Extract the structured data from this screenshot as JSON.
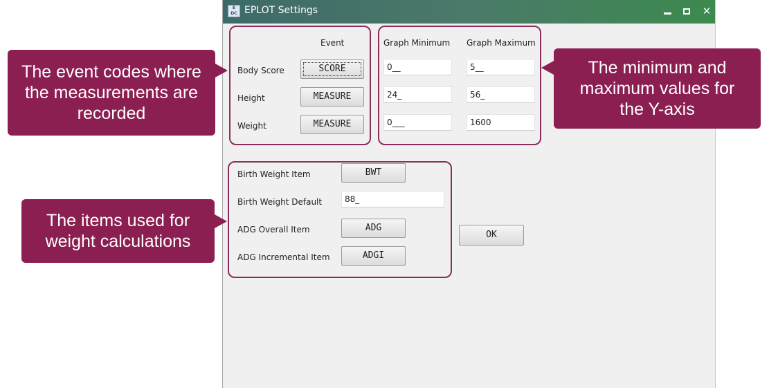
{
  "window": {
    "title": "EPLOT Settings",
    "icon": "eplot-app-icon",
    "minimize_icon": "minimize-icon",
    "maximize_icon": "maximize-icon",
    "close_icon": "close-icon",
    "close_glyph": "✕"
  },
  "event_section": {
    "header": "Event",
    "rows": [
      {
        "label": "Body Score",
        "button": "SCORE"
      },
      {
        "label": "Height",
        "button": "MEASURE"
      },
      {
        "label": "Weight",
        "button": "MEASURE"
      }
    ]
  },
  "graph_section": {
    "min_header": "Graph Minimum",
    "max_header": "Graph Maximum",
    "rows": [
      {
        "min": "0__",
        "max": "5__"
      },
      {
        "min": "24_",
        "max": "56_"
      },
      {
        "min": "0___",
        "max": "1600"
      }
    ]
  },
  "weight_section": {
    "birth_weight_item_label": "Birth Weight Item",
    "birth_weight_item_button": "BWT",
    "birth_weight_default_label": "Birth Weight Default",
    "birth_weight_default_value": "88_",
    "adg_overall_label": "ADG Overall Item",
    "adg_overall_button": "ADG",
    "adg_incremental_label": "ADG Incremental Item",
    "adg_incremental_button": "ADGI"
  },
  "ok_button": "OK",
  "callouts": {
    "event_codes": "The event codes where the measurements are recorded",
    "min_max": "The minimum and maximum values for the Y-axis",
    "weight_items": "The items used for weight calculations"
  },
  "colors": {
    "callout_bg": "#8b1f52",
    "highlight_border": "#8b2d5d",
    "titlebar": "#4b7a6a"
  }
}
